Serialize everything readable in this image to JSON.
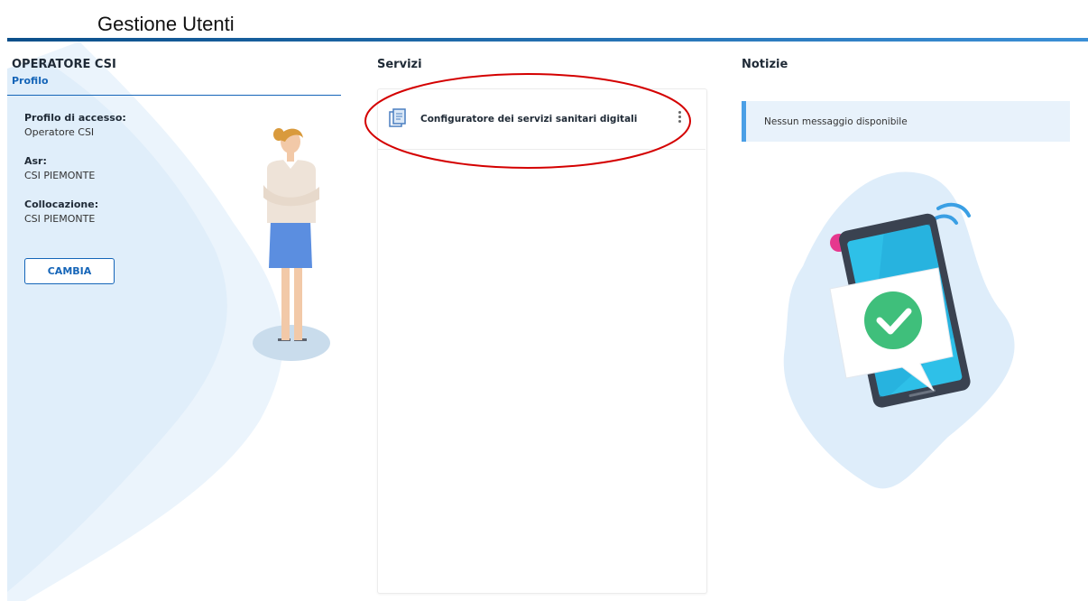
{
  "document": {
    "title": "Gestione Utenti"
  },
  "left": {
    "heading": "OPERATORE CSI",
    "profile_link": "Profilo",
    "fields": [
      {
        "label": "Profilo di accesso:",
        "value": "Operatore CSI"
      },
      {
        "label": "Asr:",
        "value": "CSI PIEMONTE"
      },
      {
        "label": "Collocazione:",
        "value": "CSI PIEMONTE"
      }
    ],
    "change_button": "CAMBIA"
  },
  "services": {
    "heading": "Servizi",
    "items": [
      {
        "label": "Configuratore dei servizi sanitari digitali",
        "icon": "document-icon"
      }
    ]
  },
  "news": {
    "heading": "Notizie",
    "message": "Nessun messaggio disponibile"
  },
  "colors": {
    "accent": "#1565b8",
    "annotation": "#d40000",
    "news_border": "#4a9fe6",
    "news_bg": "#e8f2fb"
  }
}
